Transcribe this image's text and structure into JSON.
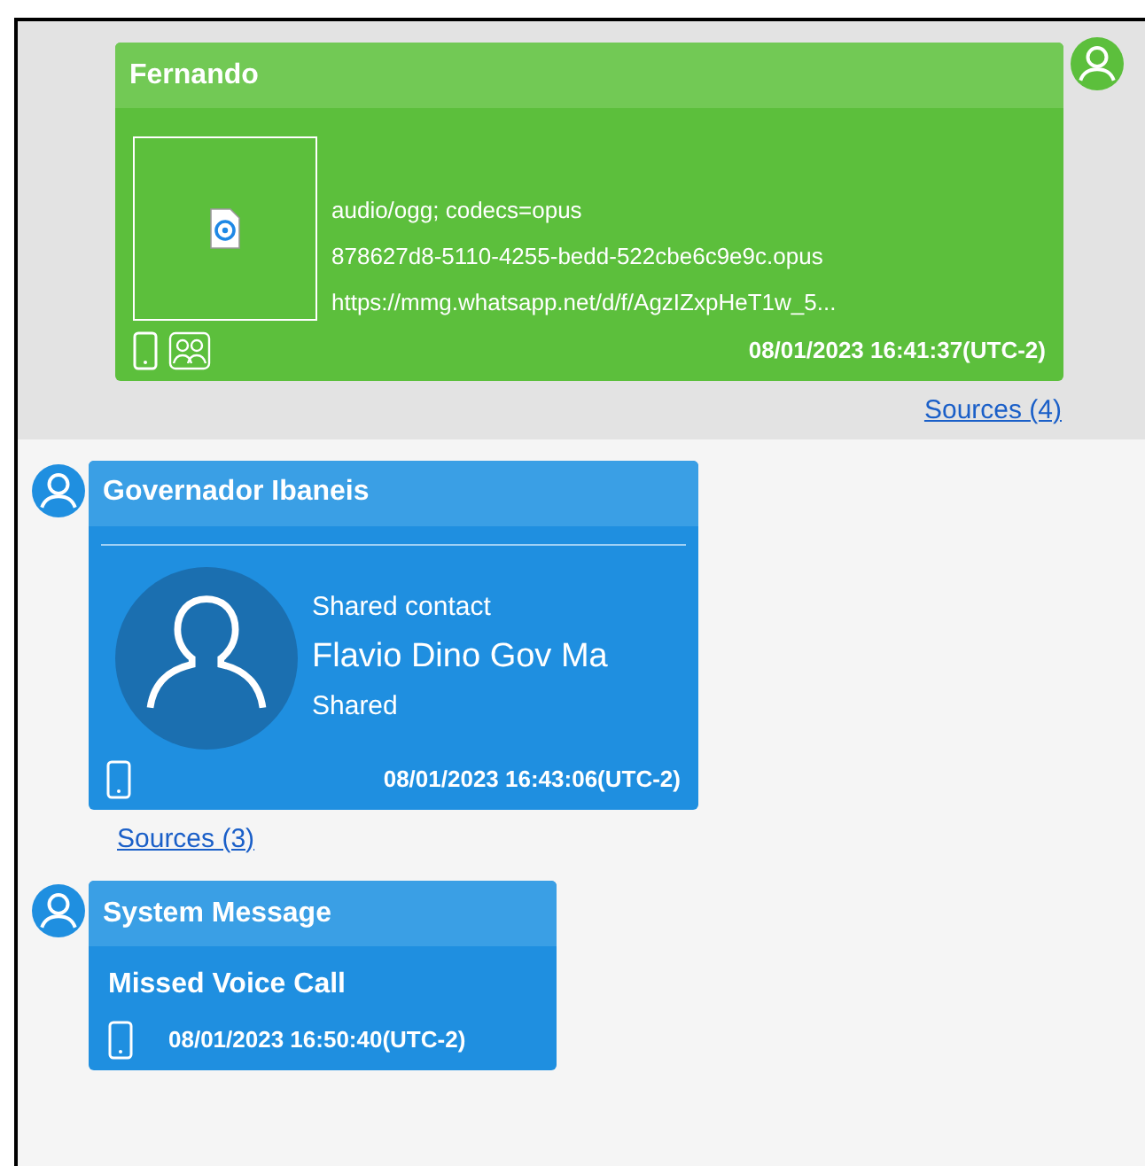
{
  "messages": [
    {
      "kind": "attachment",
      "outgoing": true,
      "sender": "Fernando",
      "lines": [
        "audio/ogg; codecs=opus",
        "878627d8-5110-4255-bedd-522cbe6c9e9c.opus",
        "https://mmg.whatsapp.net/d/f/AgzIZxpHeT1w_5..."
      ],
      "group": true,
      "timestamp": "08/01/2023 16:41:37(UTC-2)",
      "sources": "Sources (4)"
    },
    {
      "kind": "contact",
      "outgoing": false,
      "sender": "Governador Ibaneis",
      "label": "Shared contact",
      "contact_name": "Flavio Dino Gov Ma",
      "status": "Shared",
      "group": false,
      "timestamp": "08/01/2023 16:43:06(UTC-2)",
      "sources": "Sources (3)"
    },
    {
      "kind": "system",
      "outgoing": false,
      "sender": "System Message",
      "text": "Missed Voice Call",
      "group": false,
      "timestamp": "08/01/2023 16:50:40(UTC-2)"
    }
  ]
}
